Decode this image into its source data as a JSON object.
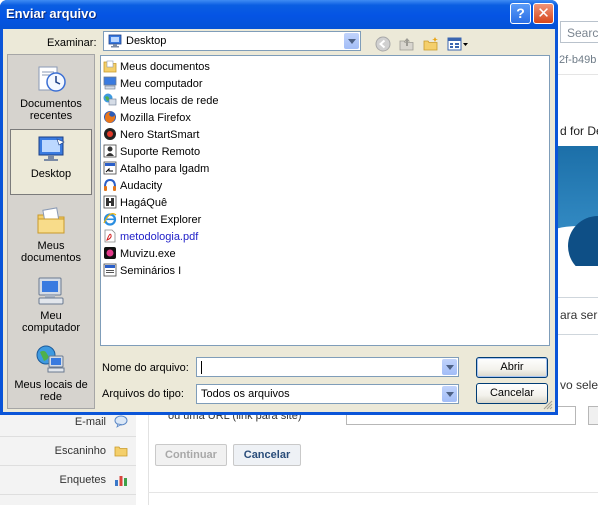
{
  "background": {
    "search_placeholder": "Searc",
    "hash_fragment": "2f-b49b",
    "title_fragment": "d for De",
    "text_fragment1": "ara ser a",
    "text_fragment2": "vo sele",
    "url_label": "ou uma URL (link para site)",
    "continue_button": "Continuar",
    "cancel_button": "Cancelar",
    "sidebar": [
      {
        "label": "E-mail",
        "icon": "speech-bubble-icon"
      },
      {
        "label": "Escaninho",
        "icon": "folder-icon"
      },
      {
        "label": "Enquetes",
        "icon": "bar-chart-icon"
      }
    ]
  },
  "dialog": {
    "title": "Enviar arquivo",
    "help_glyph": "?",
    "close_glyph": "✕",
    "look_in_label": "Examinar:",
    "look_in_value": "Desktop",
    "places": [
      {
        "label": "Documentos recentes",
        "icon": "recent-documents-icon"
      },
      {
        "label": "Desktop",
        "icon": "desktop-icon"
      },
      {
        "label": "Meus documentos",
        "icon": "my-documents-icon"
      },
      {
        "label": "Meu computador",
        "icon": "my-computer-icon"
      },
      {
        "label": "Meus locais de rede",
        "icon": "network-places-icon"
      }
    ],
    "files": [
      {
        "name": "Meus documentos",
        "icon": "folder-docs-icon"
      },
      {
        "name": "Meu computador",
        "icon": "computer-icon"
      },
      {
        "name": "Meus locais de rede",
        "icon": "network-icon"
      },
      {
        "name": "Mozilla Firefox",
        "icon": "firefox-icon"
      },
      {
        "name": "Nero StartSmart",
        "icon": "nero-icon"
      },
      {
        "name": "Suporte Remoto",
        "icon": "remote-support-icon"
      },
      {
        "name": "Atalho para lgadm",
        "icon": "shortcut-icon"
      },
      {
        "name": "Audacity",
        "icon": "audacity-icon"
      },
      {
        "name": "HagáQuê",
        "icon": "hagaque-icon"
      },
      {
        "name": "Internet Explorer",
        "icon": "ie-icon"
      },
      {
        "name": "metodologia.pdf",
        "icon": "pdf-icon"
      },
      {
        "name": "Muvizu.exe",
        "icon": "exe-icon"
      },
      {
        "name": "Seminários I",
        "icon": "doc-icon"
      }
    ],
    "filename_label": "Nome do arquivo:",
    "filename_value": "",
    "filetype_label": "Arquivos do tipo:",
    "filetype_value": "Todos os arquivos",
    "open_button": "Abrir",
    "cancel_button": "Cancelar"
  }
}
